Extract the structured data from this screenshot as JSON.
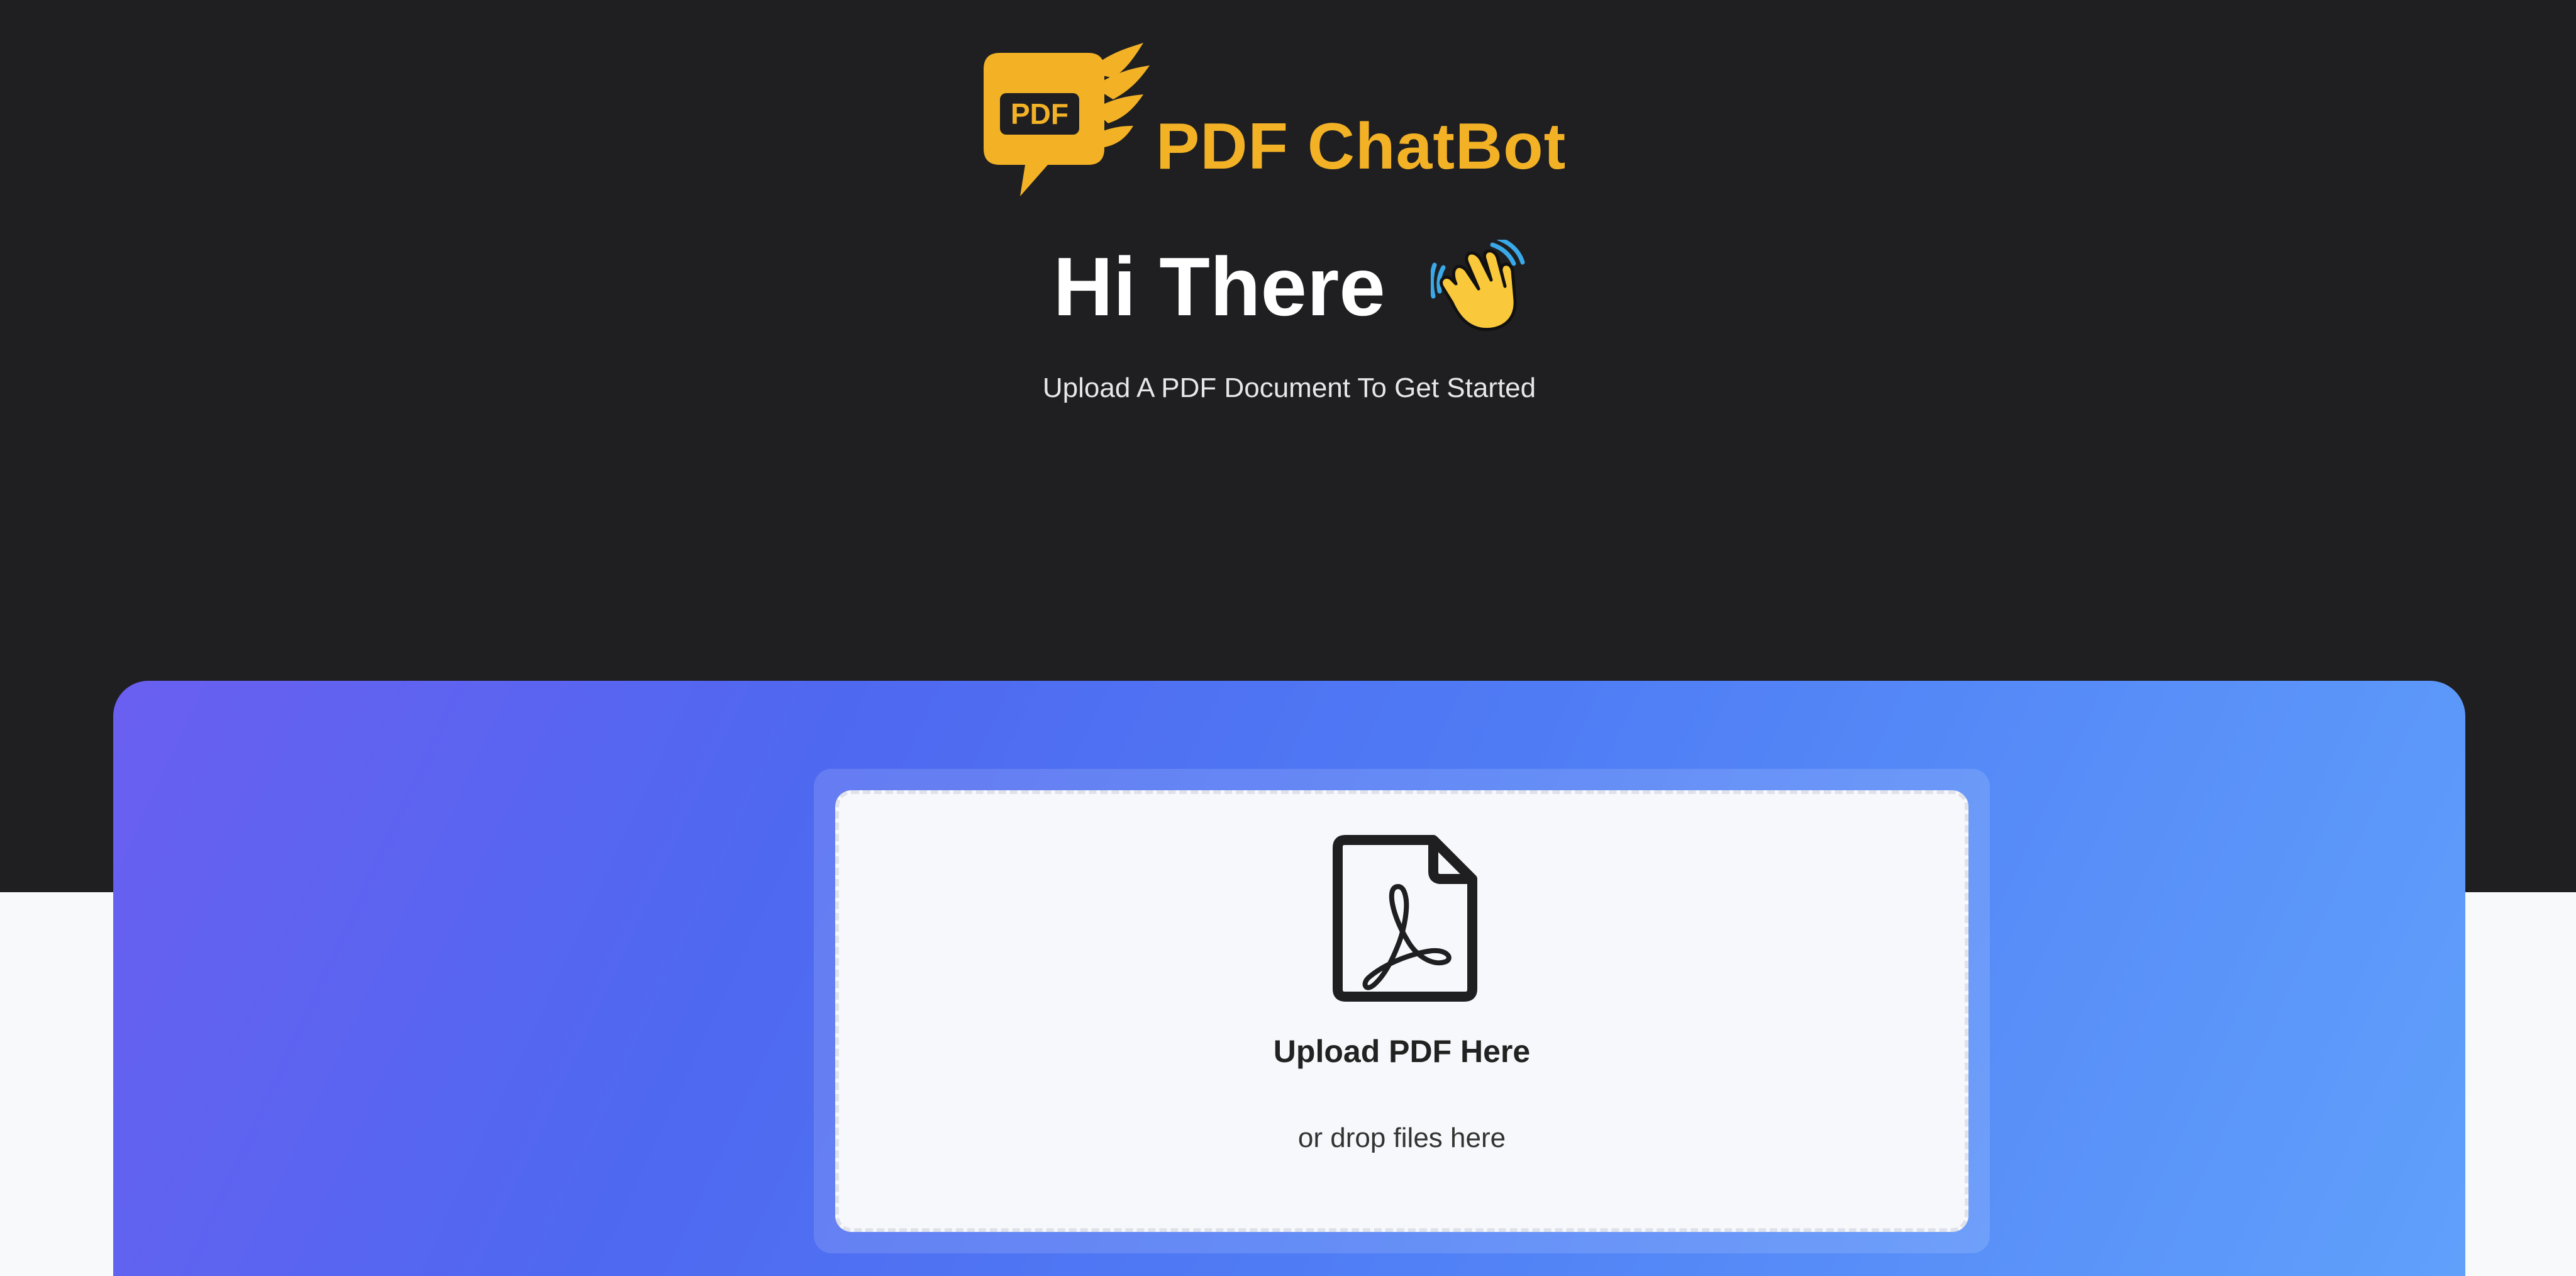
{
  "brand": {
    "name": "PDF ChatBot",
    "logo_text": "PDF",
    "accent_color": "#f3b225"
  },
  "hero": {
    "greeting": "Hi There",
    "greeting_icon": "waving-hand-icon",
    "subtitle": "Upload A PDF Document To Get Started"
  },
  "upload": {
    "title": "Upload PDF Here",
    "subtitle": "or drop files here",
    "icon": "pdf-file-icon",
    "gradient_colors": [
      "#6a5ff0",
      "#4f68f0",
      "#60a0fb"
    ]
  }
}
